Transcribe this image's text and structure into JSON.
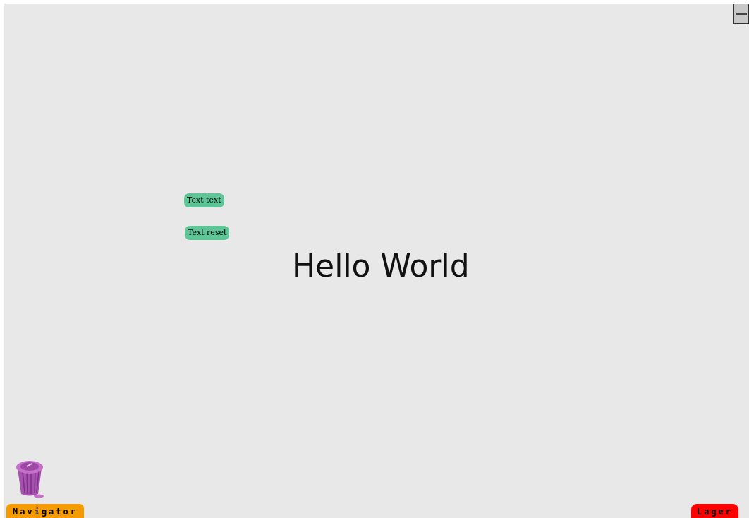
{
  "buttons": [
    {
      "label": "Text text"
    },
    {
      "label": "Text reset"
    }
  ],
  "heading": "Hello World",
  "navigator": {
    "label": "Navigator"
  },
  "layer": {
    "label": "Lager"
  }
}
